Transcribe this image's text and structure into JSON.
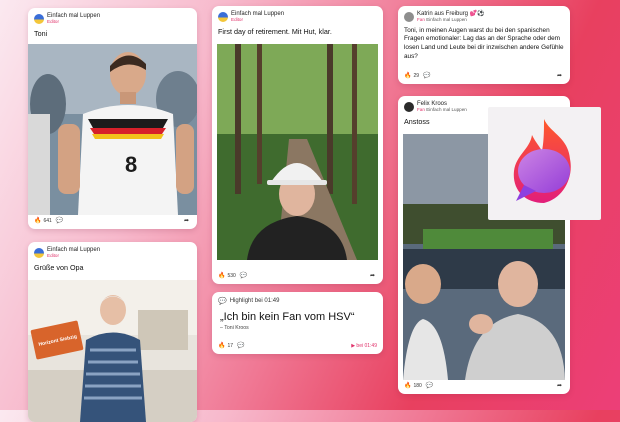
{
  "posts": [
    {
      "author": "Einfach mal Luppen",
      "role": "Editor",
      "text": "Toni",
      "likes": "641"
    },
    {
      "author": "Einfach mal Luppen",
      "role": "Editor",
      "text": "Grüße von Opa",
      "photo_caption": "Horizont Siebzig"
    },
    {
      "author": "Einfach mal Luppen",
      "role": "Editor",
      "text": "First day of retirement. Mit Hut, klar.",
      "likes": "530"
    },
    {
      "author": "Katrin aus Freiburg",
      "author_emoji": "💕⚽",
      "role": "Fan",
      "role_target": "Einfach mal Luppen",
      "text": "Toni, in meinen Augen warst du bei den spanischen Fragen emotionaler: Lag das an der Sprache oder dem losen Land und Leute bei dir inzwischen andere Gefühle aus?",
      "likes": "29"
    },
    {
      "author": "Felix Kroos",
      "role": "Fan",
      "role_target": "Einfach mal Luppen",
      "text": "Anstoss",
      "likes": "180"
    }
  ],
  "highlight": {
    "label": "Highlight bei 01:49",
    "quote": "„Ich bin kein Fan vom HSV“",
    "quote_author": "– Toni Kroos",
    "likes": "17",
    "timestamp_link": "▶ bei 01:49"
  },
  "colors": {
    "accent": "#e0336b",
    "flame_top": "#ff5a2a",
    "flame_bottom": "#e21e7a",
    "bubble": "#a458e8"
  },
  "icons": {
    "like": "flame-icon",
    "comment": "speech-bubble-icon",
    "share": "share-arrow-icon",
    "logo": "flame-chat-logo-icon"
  }
}
